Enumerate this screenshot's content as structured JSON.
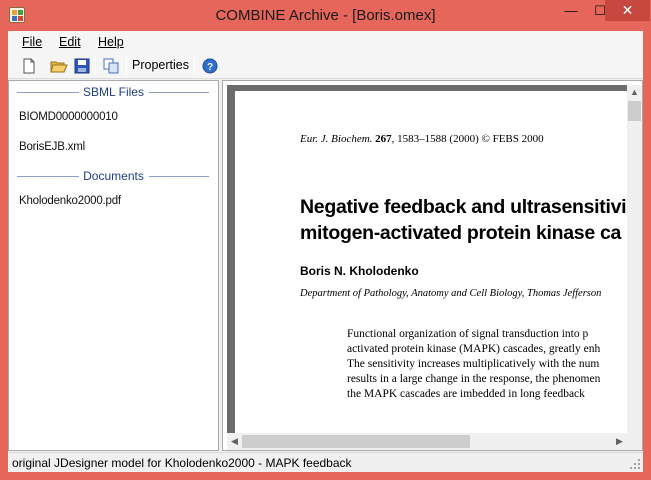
{
  "window": {
    "title": "COMBINE Archive - [Boris.omex]",
    "app_icon": "combine-archive-icon",
    "controls": {
      "minimize": "—",
      "maximize": "☐",
      "close": "✕"
    }
  },
  "menu": {
    "items": [
      {
        "label": "File",
        "mnemonic": "F"
      },
      {
        "label": "Edit",
        "mnemonic": "E"
      },
      {
        "label": "Help",
        "mnemonic": "H"
      }
    ]
  },
  "toolbar": {
    "icons": [
      "new-document-icon",
      "open-folder-icon",
      "save-icon",
      "copy-icon",
      "help-icon"
    ],
    "properties_label": "Properties"
  },
  "sidebar": {
    "sbml_header": "SBML Files",
    "sbml_files": [
      "BIOMD0000000010",
      "BorisEJB.xml"
    ],
    "documents_header": "Documents",
    "documents": [
      "Kholodenko2000.pdf"
    ]
  },
  "document": {
    "journal_name": "Eur. J. Biochem.",
    "journal_volume": "267",
    "journal_rest": ", 1583–1588 (2000) © FEBS 2000",
    "title_line1": "Negative feedback and ultrasensitivi",
    "title_line2": "mitogen-activated protein kinase ca",
    "author": "Boris N. Kholodenko",
    "affiliation": "Department of Pathology, Anatomy and Cell Biology, Thomas Jefferson",
    "abstract_lines": [
      "Functional organization of signal transduction into p",
      "activated protein kinase (MAPK) cascades, greatly enh",
      "The sensitivity increases multiplicatively with the num",
      "results in a large change in the response, the phenomen",
      "the MAPK cascades are imbedded in long feedback"
    ]
  },
  "status": {
    "text": "original JDesigner model for Kholodenko2000 - MAPK feedback"
  }
}
